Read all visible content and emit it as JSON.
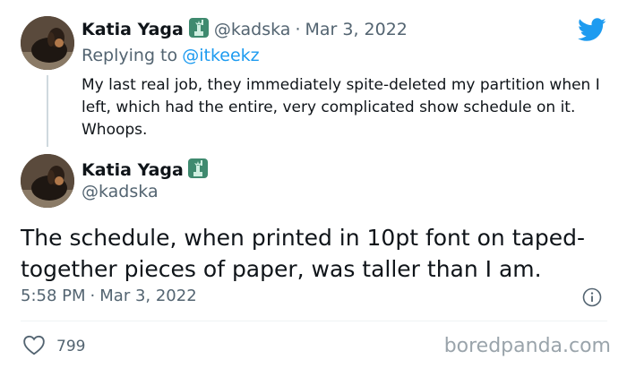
{
  "reply_tweet": {
    "author_name": "Katia Yaga",
    "handle": "@kadska",
    "separator": "·",
    "date": "Mar 3, 2022",
    "replying_prefix": "Replying to",
    "replying_to": "@itkeekz",
    "text": "My last real job, they immediately spite-deleted my partition when I left, which had the entire, very complicated show schedule on it. Whoops."
  },
  "main_tweet": {
    "author_name": "Katia Yaga",
    "handle": "@kadska",
    "text": "The schedule, when printed in 10pt font on taped-together pieces of paper, was taller than I am.",
    "time": "5:58 PM",
    "separator": "·",
    "date": "Mar 3, 2022",
    "like_count": "799"
  },
  "watermark": "boredpanda.com",
  "colors": {
    "twitter_blue": "#1d9bf0",
    "muted": "#536471",
    "flag_green": "#3f8a6f"
  },
  "icons": [
    "twitter-logo-icon",
    "statue-of-liberty-icon",
    "info-icon",
    "heart-icon"
  ]
}
